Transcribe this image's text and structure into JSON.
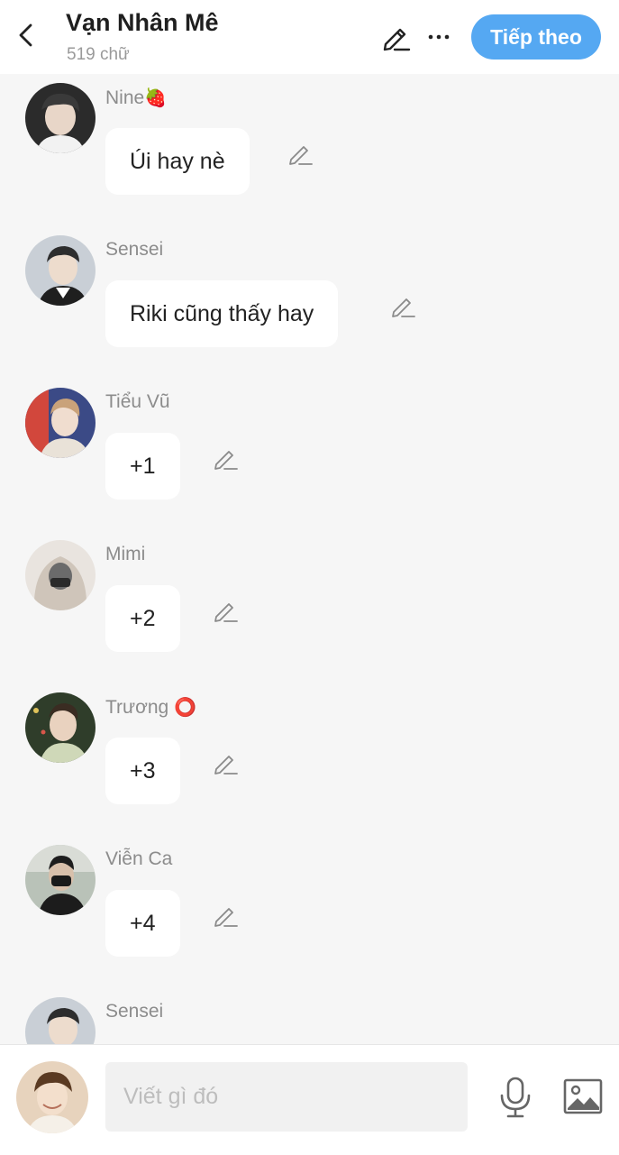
{
  "header": {
    "title": "Vạn Nhân Mê",
    "word_count": "519 chữ",
    "next_label": "Tiếp theo",
    "accent_color": "#55a8f2"
  },
  "messages": [
    {
      "name": "Nine",
      "name_emoji": "🍓",
      "text": "Úi hay nè",
      "avatar_icon": "avatar-nine"
    },
    {
      "name": "Sensei",
      "name_emoji": "",
      "text": "Riki cũng thấy hay",
      "avatar_icon": "avatar-sensei"
    },
    {
      "name": "Tiểu Vũ",
      "name_emoji": "",
      "text": "+1",
      "avatar_icon": "avatar-tieu-vu"
    },
    {
      "name": "Mimi",
      "name_emoji": "",
      "text": "+2",
      "avatar_icon": "avatar-mimi"
    },
    {
      "name": "Trương ",
      "name_emoji": "⭕",
      "text": "+3",
      "avatar_icon": "avatar-truong"
    },
    {
      "name": "Viễn Ca",
      "name_emoji": "",
      "text": "+4",
      "avatar_icon": "avatar-vien-ca"
    },
    {
      "name": "Sensei",
      "name_emoji": "",
      "text": "",
      "avatar_icon": "avatar-sensei"
    }
  ],
  "composer": {
    "placeholder": "Viết gì đó",
    "value": ""
  }
}
